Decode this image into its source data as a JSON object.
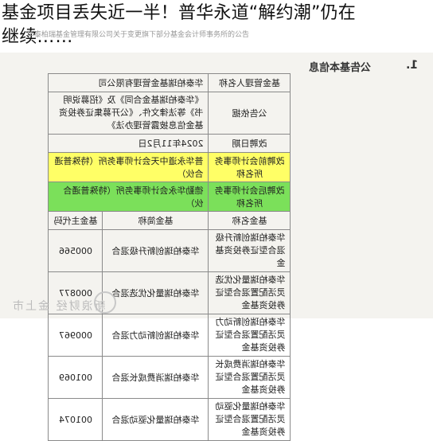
{
  "headline": {
    "line1": "基金项目丢失近一半！普华永道“解约潮”仍在",
    "line2": "继续",
    "ellipsis": "……"
  },
  "document": {
    "top_line": "华泰柏瑞基金管理有限公司关于变更旗下部分基金会计师事务所的公告",
    "section_number": "1.",
    "section_title": "公告基本信息",
    "info_rows": [
      {
        "key": "基金管理人名称",
        "value": "华泰柏瑞基金管理有限公司"
      },
      {
        "key": "公告依据",
        "value": "《华泰柏瑞基金合同》及《招募说明书》等法律文件、《公开募集证券投资基金信息披露管理办法》"
      },
      {
        "key": "改聘日期",
        "value": "2024年11月2日"
      },
      {
        "key": "改聘前会计师事务所名称",
        "value": "普华永道中天会计师事务所（特殊普通合伙）"
      },
      {
        "key": "改聘后会计师事务所名称",
        "value": "德勤华永会计师事务所（特殊普通合伙）"
      }
    ],
    "fund_header": {
      "name": "基金名称",
      "short": "基金简称",
      "code": "基金主代码"
    },
    "funds": [
      {
        "name": "华泰柏瑞创新升级混合型证券投资基金",
        "short": "华泰柏瑞创新升级混合",
        "code": "000566"
      },
      {
        "name": "华泰柏瑞量化优选灵活配置混合型证券投资基金",
        "short": "华泰柏瑞量化优选混合",
        "code": "000877"
      },
      {
        "name": "华泰柏瑞创新动力灵活配置混合型证券投资基金",
        "short": "华泰柏瑞创新动力混合",
        "code": "000967"
      },
      {
        "name": "华泰柏瑞消费成长灵活配置混合型证券投资基金",
        "short": "华泰柏瑞消费成长混合",
        "code": "001069"
      },
      {
        "name": "华泰柏瑞量化驱动灵活配置混合型证券投资基金",
        "short": "华泰柏瑞量化驱动混合",
        "code": "001074"
      }
    ]
  },
  "watermark": {
    "text": "新浪财经 金上市"
  },
  "colors": {
    "highlight_before": "#ffff66",
    "highlight_after": "#7be05a"
  }
}
